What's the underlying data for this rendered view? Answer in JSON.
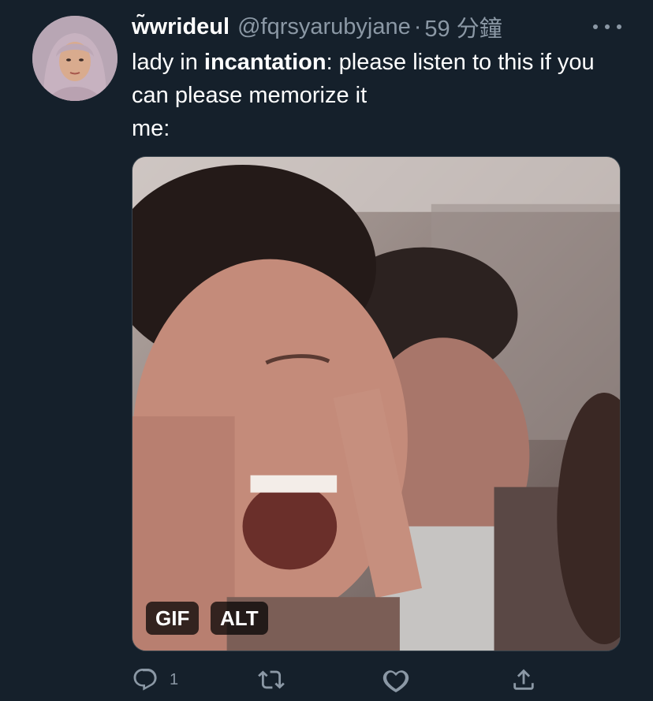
{
  "tweet": {
    "display_name": "w̃wrideul",
    "handle": "@fqrsyarubyjane",
    "separator": "·",
    "time": "59 分鐘",
    "text_part1": "lady in ",
    "text_bold": "incantation",
    "text_part2": ": please listen to this if you can please memorize it",
    "text_line3": "me:"
  },
  "media": {
    "gif_label": "GIF",
    "alt_label": "ALT"
  },
  "actions": {
    "reply_count": "1",
    "icons": [
      "reply-icon",
      "retweet-icon",
      "like-icon",
      "share-icon"
    ]
  },
  "colors": {
    "background": "#15202b",
    "secondary_text": "#8b98a5",
    "primary_text": "#ffffff"
  }
}
